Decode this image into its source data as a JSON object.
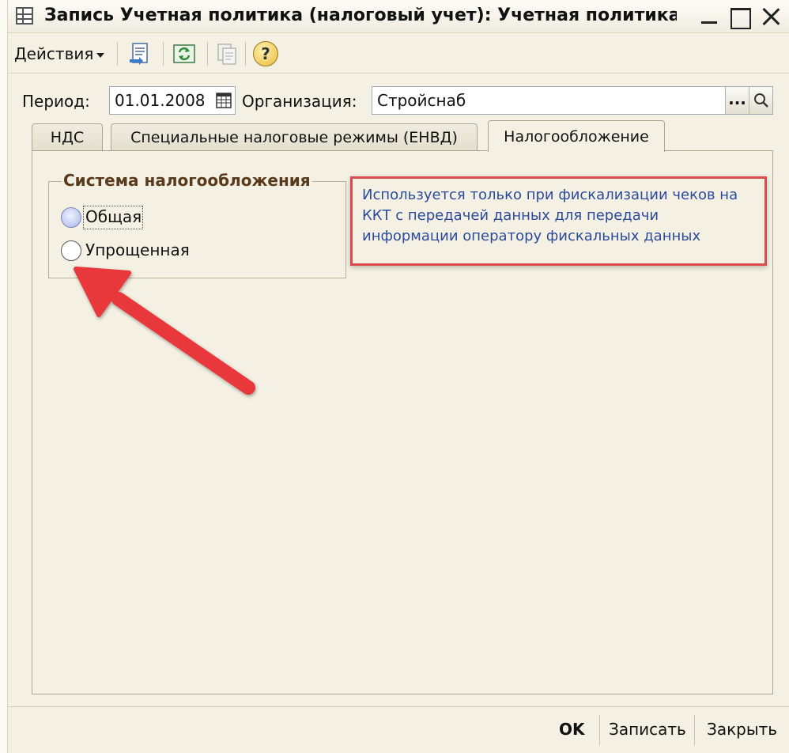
{
  "window": {
    "title": "Запись Учетная политика (налоговый учет): Учетная политика (на..."
  },
  "toolbar": {
    "actions_label": "Действия",
    "help_symbol": "?"
  },
  "fields": {
    "period_label": "Период:",
    "period_value": "01.01.2008",
    "organization_label": "Организация:",
    "organization_value": "Стройснаб",
    "select_button_label": "..."
  },
  "tabs": [
    {
      "label": "НДС",
      "active": false
    },
    {
      "label": "Специальные налоговые режимы (ЕНВД)",
      "active": false
    },
    {
      "label": "Налогообложение",
      "active": true
    }
  ],
  "tax_system": {
    "group_title": "Система налогообложения",
    "options": [
      {
        "label": "Общая",
        "selected": true
      },
      {
        "label": "Упрощенная",
        "selected": false
      }
    ]
  },
  "note": {
    "text": "Используется только при фискализации чеков на ККТ с передачей данных для передачи информации оператору фискальных данных"
  },
  "footer": {
    "ok_label": "OK",
    "save_label": "Записать",
    "close_label": "Закрыть"
  },
  "colors": {
    "window_bg": "#f4f1e4",
    "annotation_red": "#dc4b4b",
    "note_text": "#2c4a9a",
    "group_title": "#5a3a1c"
  },
  "icons": {
    "window": "table-grid-icon",
    "post": "post-document-icon",
    "refresh": "refresh-icon",
    "copy": "copy-icon",
    "help": "help-icon",
    "calendar": "calendar-icon",
    "search": "search-icon",
    "annotation": "red-arrow-icon"
  }
}
